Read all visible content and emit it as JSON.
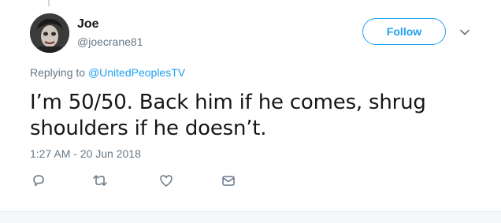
{
  "tweet": {
    "author_name": "Joe",
    "author_handle": "@joecrane81",
    "follow_label": "Follow",
    "reply_prefix": "Replying to ",
    "reply_to": "@UnitedPeoplesTV",
    "text": "I’m 50/50. Back him if he comes, shrug shoulders if he doesn’t.",
    "timestamp": "1:27 AM - 20 Jun 2018"
  },
  "icons": {
    "caret": "chevron-down-icon",
    "reply": "reply-icon",
    "retweet": "retweet-icon",
    "like": "heart-icon",
    "message": "envelope-icon"
  },
  "colors": {
    "accent": "#1da1f2",
    "secondary_text": "#657786",
    "primary_text": "#14171a"
  }
}
